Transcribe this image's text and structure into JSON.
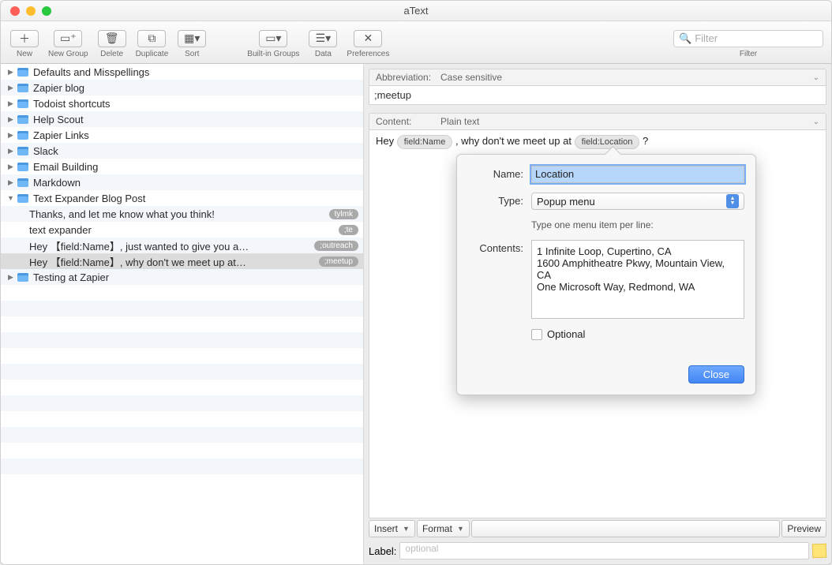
{
  "window": {
    "title": "aText"
  },
  "toolbar": {
    "new": "New",
    "newGroup": "New Group",
    "delete": "Delete",
    "duplicate": "Duplicate",
    "sort": "Sort",
    "builtin": "Built-in Groups",
    "data": "Data",
    "prefs": "Preferences",
    "filterLabel": "Filter",
    "filterPlaceholder": "Filter"
  },
  "sidebar": {
    "groups": [
      "Defaults and Misspellings",
      "Zapier blog",
      "Todoist shortcuts",
      "Help Scout",
      "Zapier Links",
      "Slack",
      "Email Building",
      "Markdown",
      "Text Expander Blog Post",
      "Testing at Zapier"
    ],
    "snippets": [
      {
        "text": "Thanks, and let me know what you think!",
        "abbr": "tylmk"
      },
      {
        "text": "text expander",
        "abbr": ";te"
      },
      {
        "text": "Hey 【field:Name】, just wanted to give you a…",
        "abbr": ";outreach"
      },
      {
        "text": "Hey 【field:Name】, why don't we meet up at…",
        "abbr": ";meetup"
      }
    ]
  },
  "detail": {
    "abbrevLabel": "Abbreviation:",
    "abbrevMode": "Case sensitive",
    "abbrevValue": ";meetup",
    "contentLabel": "Content:",
    "contentMode": "Plain text",
    "contentPre": "Hey ",
    "field1": "field:Name",
    "contentMid": ", why don't we meet up at ",
    "field2": "field:Location",
    "contentPost": "?",
    "insert": "Insert",
    "format": "Format",
    "preview": "Preview",
    "labelLabel": "Label:",
    "labelPlaceholder": "optional"
  },
  "popover": {
    "nameLabel": "Name:",
    "nameValue": "Location",
    "typeLabel": "Type:",
    "typeValue": "Popup menu",
    "instr": "Type one menu item per line:",
    "contentsLabel": "Contents:",
    "contents": "1 Infinite Loop, Cupertino, CA\n1600 Amphitheatre Pkwy, Mountain View, CA\nOne Microsoft Way, Redmond, WA",
    "optional": "Optional",
    "close": "Close"
  }
}
